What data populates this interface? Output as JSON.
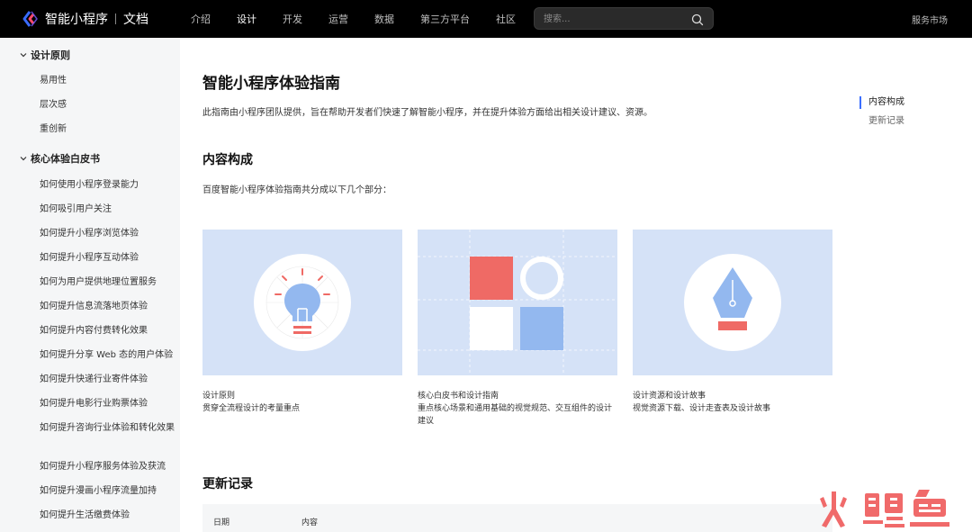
{
  "header": {
    "brand": "智能小程序",
    "section": "文档",
    "nav": [
      {
        "label": "介绍",
        "active": false
      },
      {
        "label": "设计",
        "active": true
      },
      {
        "label": "开发",
        "active": false
      },
      {
        "label": "运营",
        "active": false
      },
      {
        "label": "数据",
        "active": false
      },
      {
        "label": "第三方平台",
        "active": false
      },
      {
        "label": "社区",
        "active": false
      }
    ],
    "search_placeholder": "搜索...",
    "market": "服务市场"
  },
  "sidebar": {
    "groups": [
      {
        "title": "设计原则",
        "items": [
          "易用性",
          "层次感",
          "重创新"
        ]
      },
      {
        "title": "核心体验白皮书",
        "items": [
          "如何使用小程序登录能力",
          "如何吸引用户关注",
          "如何提升小程序浏览体验",
          "如何提升小程序互动体验",
          "如何为用户提供地理位置服务",
          "如何提升信息流落地页体验",
          "如何提升内容付费转化效果",
          "如何提升分享 Web 态的用户体验",
          "如何提升快递行业寄件体验",
          "如何提升电影行业购票体验",
          "如何提升咨询行业体验和转化效果",
          "如何提升小程序服务体验及获流",
          "如何提升漫画小程序流量加持",
          "如何提升生活缴费体验"
        ]
      }
    ]
  },
  "main": {
    "title": "智能小程序体验指南",
    "intro": "此指南由小程序团队提供，旨在帮助开发者们快速了解智能小程序，并在提升体验方面给出相关设计建议、资源。",
    "content_heading": "内容构成",
    "content_desc": "百度智能小程序体验指南共分成以下几个部分：",
    "cards": [
      {
        "title": "设计原则",
        "desc": "贯穿全流程设计的考量重点"
      },
      {
        "title": "核心白皮书和设计指南",
        "desc": "重点核心场景和通用基础的视觉规范、交互组件的设计建议"
      },
      {
        "title": "设计资源和设计故事",
        "desc": "视觉资源下载、设计走查表及设计故事"
      }
    ],
    "updates_heading": "更新记录",
    "table_headers": [
      "日期",
      "内容"
    ]
  },
  "toc": {
    "items": [
      {
        "label": "内容构成",
        "active": true
      },
      {
        "label": "更新记录",
        "active": false
      }
    ]
  },
  "colors": {
    "topbar_bg": "#000000",
    "sidebar_bg": "#f5f6f7",
    "card_bg": "#d5e2f7",
    "accent_red": "#ef6a65",
    "accent_blue": "#93b8ef",
    "toc_active": "#3b6fff",
    "watermark_red": "#f06a6a"
  },
  "watermark": "火鲤鱼"
}
